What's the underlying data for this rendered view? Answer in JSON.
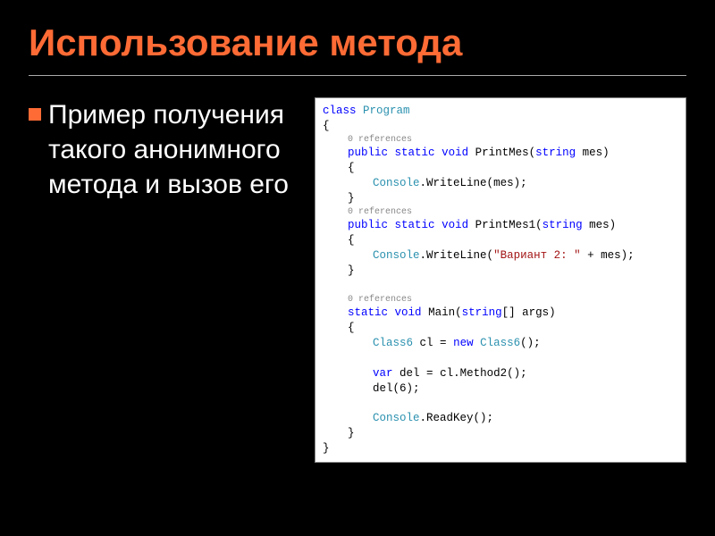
{
  "title": "Использование метода",
  "bullet_text": "Пример получения такого анонимного метода и вызов его",
  "ref_label": "0 references",
  "code": {
    "class_kw": "class",
    "program": "Program",
    "public": "public",
    "static": "static",
    "void": "void",
    "string_t": "string",
    "string_arr": "string",
    "new_kw": "new",
    "var_kw": "var",
    "m1_name": "PrintMes",
    "m1_param": "mes",
    "m2_name": "PrintMes1",
    "m2_param": "mes",
    "console": "Console",
    "writeline": "WriteLine",
    "readkey": "ReadKey",
    "str_lit": "\"Вариант 2: \"",
    "main": "Main",
    "args": "args",
    "class6": "Class6",
    "cl": "cl",
    "del": "del",
    "method2": "Method2",
    "del_arg": "6"
  }
}
